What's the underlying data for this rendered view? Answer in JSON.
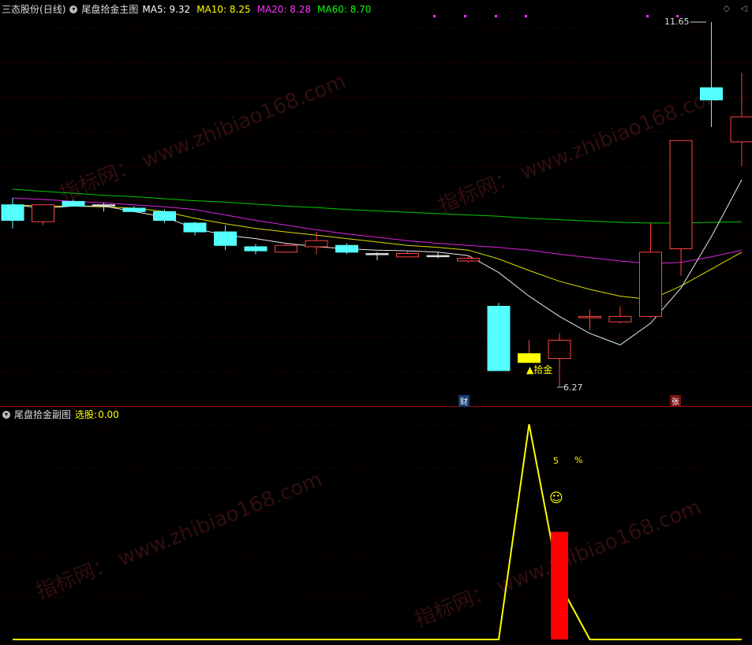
{
  "main_chart": {
    "stock_name": "三态股份",
    "period": "(日线)",
    "indicator_name": "尾盘拾金主图",
    "ma": [
      {
        "label": "MA5:",
        "value": "9.32",
        "color": "#ffffff"
      },
      {
        "label": "MA10:",
        "value": "8.25",
        "color": "#ffff00"
      },
      {
        "label": "MA20:",
        "value": "8.28",
        "color": "#ff33ff"
      },
      {
        "label": "MA60:",
        "value": "8.70",
        "color": "#00ff00"
      }
    ],
    "high_label": "11.65",
    "low_label": "6.27",
    "signal_label": "▲拾金",
    "marker_cai": "财",
    "marker_zhang": "张"
  },
  "sub_chart": {
    "indicator_name": "尾盘拾金副图",
    "xuangu_label": "选股:",
    "xuangu_value": "0.00",
    "num_label": "5",
    "pct_label": "%",
    "smile": "☺"
  },
  "watermark": {
    "site": "www.zhibiao168.com",
    "brand": "指标网："
  },
  "chart_data": {
    "type": "candlestick",
    "price_axis": [
      6,
      12
    ],
    "candles": [
      {
        "o": 8.95,
        "h": 9.05,
        "l": 8.6,
        "c": 8.72,
        "col": "down"
      },
      {
        "o": 8.7,
        "h": 8.95,
        "l": 8.65,
        "c": 8.95,
        "col": "up"
      },
      {
        "o": 9.0,
        "h": 9.03,
        "l": 8.93,
        "c": 8.93,
        "col": "down"
      },
      {
        "o": 8.95,
        "h": 8.98,
        "l": 8.85,
        "c": 8.95,
        "col": "doji"
      },
      {
        "o": 8.9,
        "h": 8.93,
        "l": 8.84,
        "c": 8.85,
        "col": "down"
      },
      {
        "o": 8.85,
        "h": 8.88,
        "l": 8.68,
        "c": 8.72,
        "col": "down"
      },
      {
        "o": 8.68,
        "h": 8.7,
        "l": 8.5,
        "c": 8.55,
        "col": "down"
      },
      {
        "o": 8.55,
        "h": 8.65,
        "l": 8.28,
        "c": 8.35,
        "col": "down"
      },
      {
        "o": 8.33,
        "h": 8.37,
        "l": 8.22,
        "c": 8.27,
        "col": "down"
      },
      {
        "o": 8.25,
        "h": 8.38,
        "l": 8.25,
        "c": 8.35,
        "col": "up"
      },
      {
        "o": 8.33,
        "h": 8.55,
        "l": 8.22,
        "c": 8.42,
        "col": "up"
      },
      {
        "o": 8.35,
        "h": 8.38,
        "l": 8.22,
        "c": 8.25,
        "col": "down"
      },
      {
        "o": 8.23,
        "h": 8.25,
        "l": 8.13,
        "c": 8.23,
        "col": "doji"
      },
      {
        "o": 8.18,
        "h": 8.27,
        "l": 8.18,
        "c": 8.23,
        "col": "up"
      },
      {
        "o": 8.2,
        "h": 8.25,
        "l": 8.16,
        "c": 8.2,
        "col": "doji"
      },
      {
        "o": 8.12,
        "h": 8.2,
        "l": 8.1,
        "c": 8.16,
        "col": "up"
      },
      {
        "o": 7.45,
        "h": 7.5,
        "l": 6.5,
        "c": 6.5,
        "col": "down"
      },
      {
        "o": 6.75,
        "h": 6.95,
        "l": 6.65,
        "c": 6.62,
        "col": "signal"
      },
      {
        "o": 6.68,
        "h": 7.05,
        "l": 6.27,
        "c": 6.95,
        "col": "up"
      },
      {
        "o": 7.28,
        "h": 7.4,
        "l": 7.1,
        "c": 7.3,
        "col": "up"
      },
      {
        "o": 7.22,
        "h": 7.45,
        "l": 7.2,
        "c": 7.3,
        "col": "up"
      },
      {
        "o": 7.3,
        "h": 8.68,
        "l": 7.28,
        "c": 8.25,
        "col": "up"
      },
      {
        "o": 8.3,
        "h": 9.9,
        "l": 7.9,
        "c": 9.9,
        "col": "up"
      },
      {
        "o": 10.68,
        "h": 11.65,
        "l": 10.1,
        "c": 10.5,
        "col": "down"
      },
      {
        "o": 9.88,
        "h": 10.9,
        "l": 9.52,
        "c": 10.25,
        "col": "up"
      }
    ],
    "ma5": [
      8.95,
      8.9,
      8.93,
      8.93,
      8.85,
      8.77,
      8.6,
      8.5,
      8.45,
      8.38,
      8.33,
      8.3,
      8.28,
      8.27,
      8.25,
      8.2,
      7.95,
      7.6,
      7.3,
      7.05,
      6.88,
      7.2,
      7.72,
      8.48,
      9.32
    ],
    "ma10": [
      8.95,
      8.93,
      8.93,
      8.92,
      8.9,
      8.85,
      8.75,
      8.67,
      8.6,
      8.55,
      8.5,
      8.45,
      8.4,
      8.35,
      8.32,
      8.28,
      8.15,
      7.98,
      7.82,
      7.7,
      7.6,
      7.55,
      7.75,
      8.0,
      8.25
    ],
    "ma20": [
      9.05,
      9.03,
      9.0,
      8.98,
      8.95,
      8.92,
      8.88,
      8.8,
      8.72,
      8.65,
      8.58,
      8.52,
      8.47,
      8.42,
      8.38,
      8.35,
      8.32,
      8.28,
      8.22,
      8.17,
      8.12,
      8.08,
      8.1,
      8.18,
      8.28
    ],
    "ma60": [
      9.18,
      9.15,
      9.12,
      9.09,
      9.07,
      9.04,
      9.01,
      8.99,
      8.96,
      8.93,
      8.91,
      8.88,
      8.86,
      8.84,
      8.82,
      8.8,
      8.78,
      8.75,
      8.73,
      8.71,
      8.69,
      8.68,
      8.68,
      8.69,
      8.7
    ],
    "sub_line": [
      0,
      0,
      0,
      0,
      0,
      0,
      0,
      0,
      0,
      0,
      0,
      0,
      0,
      0,
      0,
      0,
      0,
      100,
      26,
      0,
      0,
      0,
      0,
      0,
      0
    ],
    "sub_bar_index": 18,
    "sub_bar_value": 50,
    "sub_axis": [
      0,
      100
    ]
  }
}
